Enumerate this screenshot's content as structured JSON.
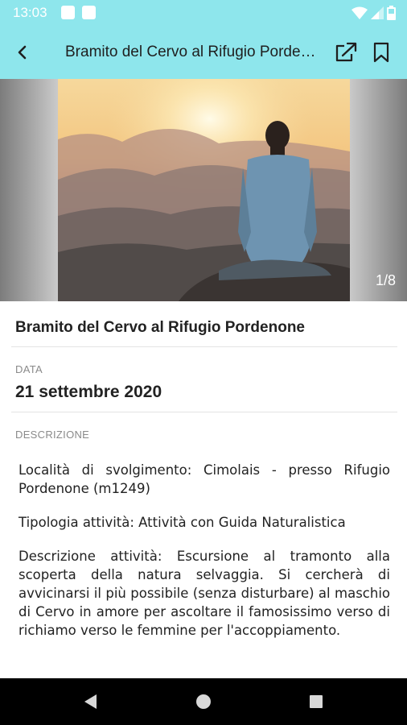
{
  "status_bar": {
    "time": "13:03",
    "notification_icons": [
      "notification-icon",
      "notification-icon"
    ],
    "icons": [
      "wifi-icon",
      "cell-signal-icon",
      "battery-icon"
    ]
  },
  "app_bar": {
    "title": "Bramito del Cervo al Rifugio Pordenone",
    "icons": [
      "back-arrow-icon",
      "open-external-icon",
      "bookmark-icon"
    ]
  },
  "gallery": {
    "counter": "1/8"
  },
  "event": {
    "title": "Bramito del Cervo al Rifugio Pordenone",
    "date_label": "DATA",
    "date_value": "21 settembre 2020",
    "description_label": "DESCRIZIONE",
    "description_paragraphs": [
      "Località di svolgimento: Cimolais - presso Rifugio Pordenone (m1249)",
      "Tipologia attività: Attività con Guida Naturalistica",
      "Descrizione attività: Escursione al tramonto alla scoperta della natura selvaggia. Si cercherà di avvicinarsi il più possibile (senza disturbare) al maschio di Cervo in amore per ascoltare il famosissimo verso di richiamo verso le femmine per l'accoppiamento."
    ]
  },
  "nav_bar": {
    "icons": [
      "back-triangle-icon",
      "home-circle-icon",
      "recents-square-icon"
    ]
  },
  "colors": {
    "app_bar": "#8ee6ec",
    "text": "#222222",
    "label": "#8a8a8a"
  }
}
